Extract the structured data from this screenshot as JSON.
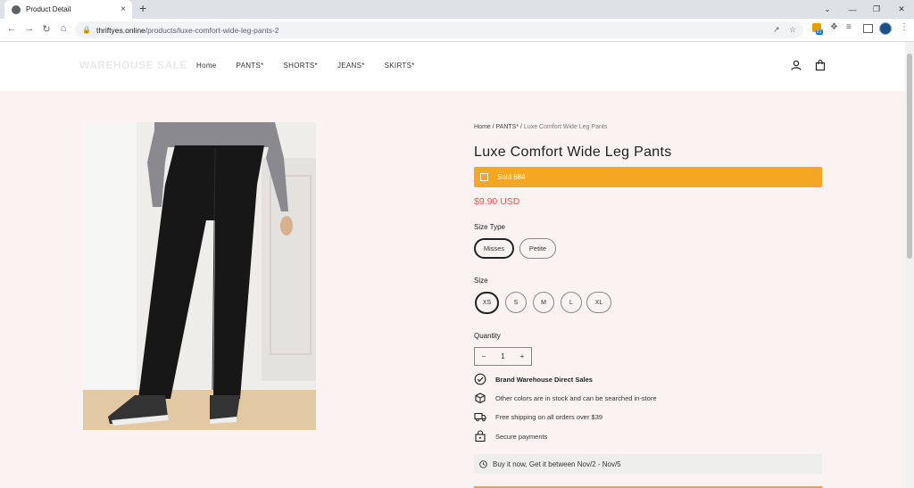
{
  "browser": {
    "tab_title": "Product Detail",
    "tab_close": "×",
    "new_tab": "+",
    "url_domain": "thriftyes.online",
    "url_path": "/products/luxe-comfort-wide-leg-pants-2",
    "window_controls": [
      "⌄",
      "—",
      "❐",
      "✕"
    ],
    "nav": {
      "back": "←",
      "forward": "→",
      "reload": "↻",
      "home": "⌂"
    },
    "extension_badge": "81"
  },
  "site": {
    "logo": "WAREHOUSE SALE",
    "nav": [
      "Home",
      "PANTS*",
      "SHORTS*",
      "JEANS*",
      "SKIRTS*"
    ]
  },
  "product": {
    "breadcrumb_home": "Home",
    "breadcrumb_sep1": " / ",
    "breadcrumb_cat": "PANTS*",
    "breadcrumb_sep2": " / ",
    "breadcrumb_current": "Luxe Comfort Wide Leg Pants",
    "title": "Luxe Comfort Wide Leg Pants",
    "sold": "Sold 684",
    "price": "$9.90 USD",
    "size_type_label": "Size Type",
    "size_types": [
      "Misses",
      "Petite"
    ],
    "size_label": "Size",
    "sizes": [
      "XS",
      "S",
      "M",
      "L",
      "XL"
    ],
    "quantity_label": "Quantity",
    "quantity": {
      "minus": "−",
      "value": "1",
      "plus": "+"
    },
    "features": [
      "Brand Warehouse Direct Sales",
      "Other colors are in stock and can be searched in-store",
      "Free shipping on all orders over $39",
      "Secure payments"
    ],
    "delivery": "Buy it now, Get it between Nov/2 - Nov/5"
  },
  "colors": {
    "accent": "#f5a623",
    "price": "#e05a4e",
    "page_bg": "#fbf3f1"
  }
}
